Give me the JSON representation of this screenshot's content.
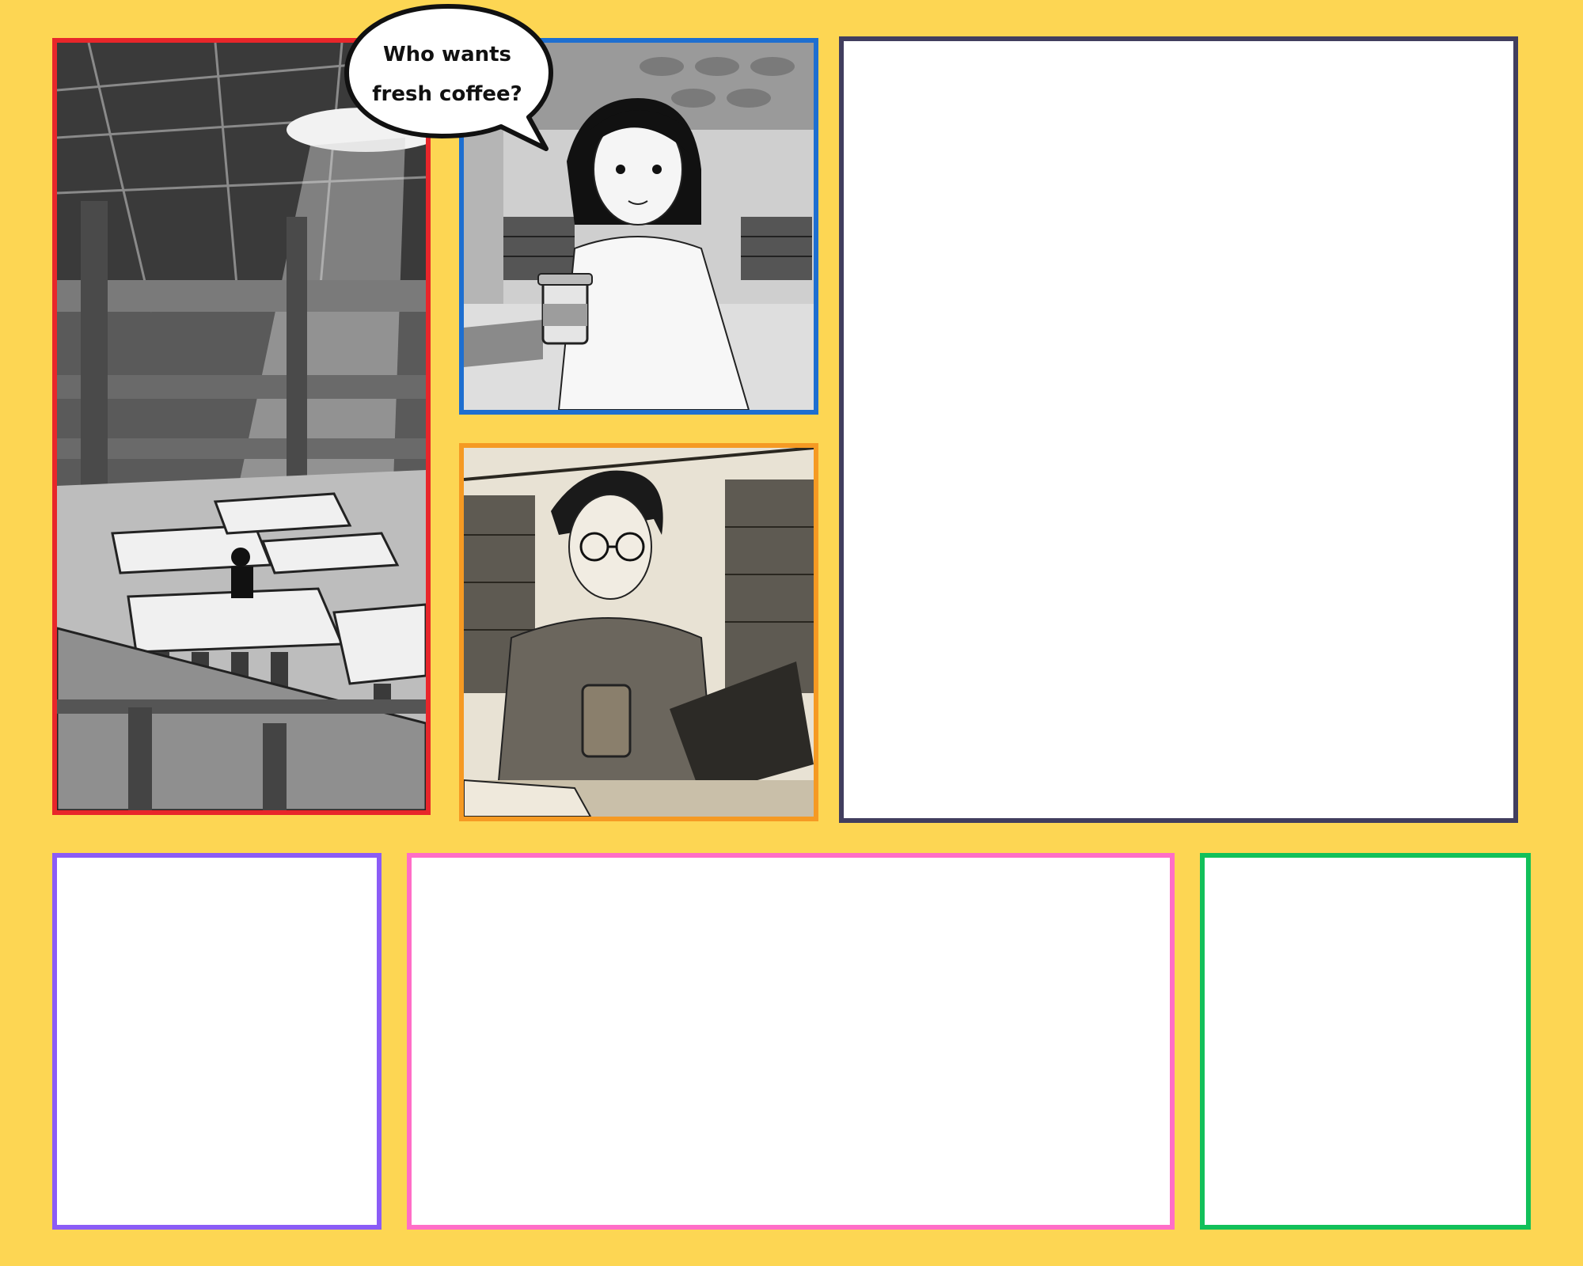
{
  "speech_bubble": {
    "line1": "Who wants",
    "line2": "fresh coffee?"
  },
  "panels": {
    "library": {
      "border_color": "#E8262A"
    },
    "woman": {
      "border_color": "#1E6FD0"
    },
    "man": {
      "border_color": "#F59A23"
    },
    "big": {
      "border_color": "#413E5E"
    },
    "purple": {
      "border_color": "#8B5CF6"
    },
    "pink": {
      "border_color": "#FF6EC7"
    },
    "green": {
      "border_color": "#12C05A"
    }
  },
  "colors": {
    "background": "#FDD653",
    "panel_fill": "#FFFFFF"
  }
}
